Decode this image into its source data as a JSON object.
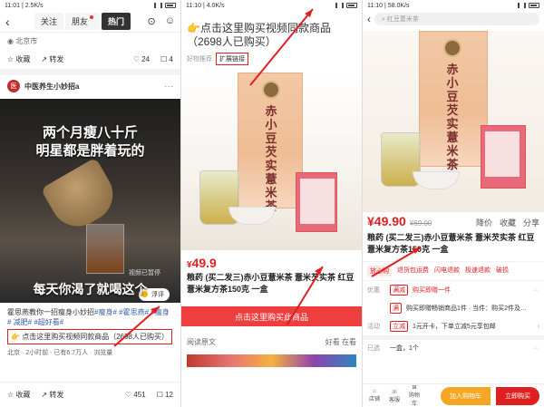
{
  "panel1": {
    "status": {
      "time": "11:01",
      "speed": "2.5K/s"
    },
    "tabs": [
      {
        "label": "关注",
        "active": false
      },
      {
        "label": "朋友",
        "active": false,
        "dot": true
      },
      {
        "label": "热门",
        "active": true
      }
    ],
    "location": "北京市",
    "actions_top": {
      "collect": "收藏",
      "share": "转发",
      "likes": "24",
      "comments": "4"
    },
    "author": "中医养生小妙招a",
    "video": {
      "caption_top_1": "两个月瘦八十斤",
      "caption_top_2": "明星都是胖着玩的",
      "caption_bottom": "每天你渴了就喝这个",
      "label": "视频已暂停",
      "bubble": "浮评"
    },
    "desc_line": "霍思燕教你一招瘦身小妙招",
    "desc_tags": "#瘦身# #霍思燕# #瘦身# 减肥# #超好看#",
    "buy_text": "点击这里购买视频同款商品（2698人已购买）",
    "desc2": "北京 · 2小时前 · 已有6.7万人 · 浏览量",
    "bottom": {
      "collect": "收藏",
      "share": "转发",
      "likes": "451",
      "comments": "12"
    }
  },
  "panel2": {
    "status": {
      "time": "11:10",
      "speed": "4.0K/s"
    },
    "title": "点击这里购买视频同款商品（2698人已购买）",
    "recommend_label": "好物推荐",
    "expand_btn": "扩展链接",
    "price": "49.9",
    "name": "粮药 (买二发三)赤小豆薏米茶 薏米芡实茶 红豆薏米复方茶150克 一盒",
    "buy_btn": "点击这里购买此商品",
    "footer_left": "阅读原文",
    "footer_right": "好看 在看"
  },
  "panel3": {
    "status": {
      "time": "11:10",
      "speed": "58.0K/s"
    },
    "search_placeholder": "红豆薏米茶",
    "price_now": "49.90",
    "price_old": "69.00",
    "icons": [
      "降价",
      "收藏",
      "分享"
    ],
    "name": "粮药 (买二发三)赤小豆薏米茶 薏米芡实茶 红豆薏米复方茶150克 一盒",
    "shop_tags": [
      "放心购",
      "退货包运费",
      "闪电退款",
      "极速退款",
      "破损"
    ],
    "rows": [
      {
        "label": "优惠",
        "tag": "满减",
        "text": "购买即赠一件"
      },
      {
        "label": "",
        "tag": "满",
        "text": "购买即赠畅销商品1件 · 当件：购买2件及…"
      },
      {
        "label": "活动",
        "tag": "立减",
        "text": "1元开卡，下单立减5元享包邮"
      }
    ],
    "selected_label": "已选",
    "selected_text": "一盒，1个",
    "bottom": {
      "shop": "店铺",
      "service": "客服",
      "cart_icon": "购物车",
      "add_cart": "加入购物车",
      "buy_now": "立即购买"
    }
  },
  "colors": {
    "accent_red": "#e02020",
    "button_red": "#ef3e3e",
    "cart_orange": "#f5a623"
  }
}
